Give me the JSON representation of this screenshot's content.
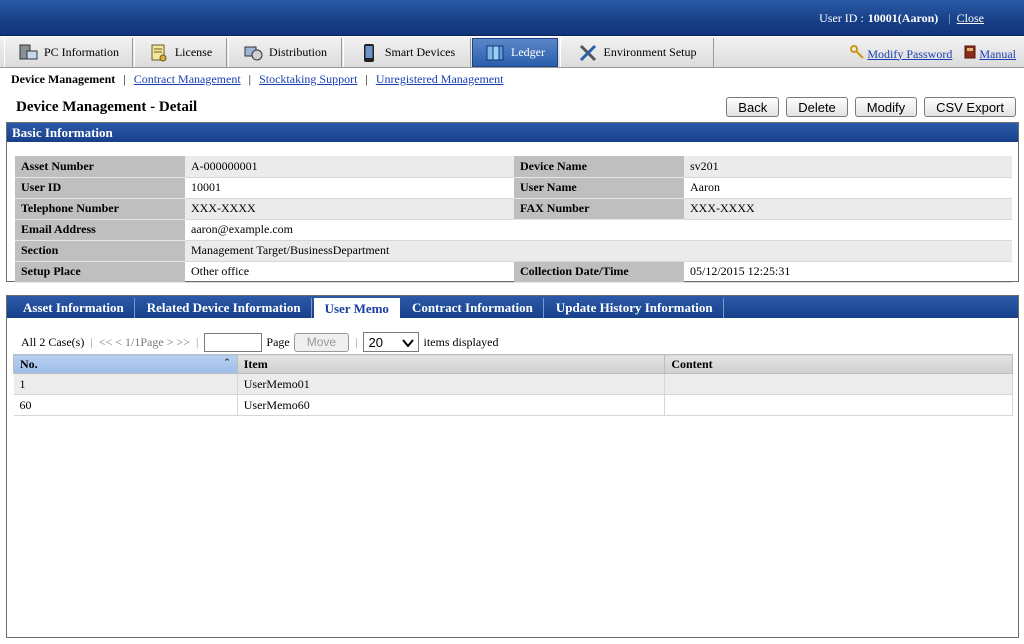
{
  "header": {
    "user_id_label": "User ID :",
    "user_id_value": "10001(Aaron)",
    "close_label": "Close"
  },
  "main_tabs": [
    {
      "label": "PC Information",
      "icon": "computer-icon"
    },
    {
      "label": "License",
      "icon": "license-icon"
    },
    {
      "label": "Distribution",
      "icon": "distribution-icon"
    },
    {
      "label": "Smart Devices",
      "icon": "smart-device-icon"
    },
    {
      "label": "Ledger",
      "icon": "ledger-icon",
      "active": true
    },
    {
      "label": "Environment Setup",
      "icon": "tools-icon"
    }
  ],
  "right_links": {
    "modify_password": "Modify Password",
    "manual": "Manual"
  },
  "subnav": {
    "current": "Device Management",
    "items": [
      "Contract Management",
      "Stocktaking Support",
      "Unregistered Management"
    ]
  },
  "page": {
    "title": "Device Management - Detail",
    "buttons": [
      "Back",
      "Delete",
      "Modify",
      "CSV Export"
    ]
  },
  "basic_info": {
    "heading": "Basic Information",
    "rows": [
      {
        "l1": "Asset Number",
        "v1": "A-000000001",
        "l2": "Device Name",
        "v2": "sv201"
      },
      {
        "l1": "User ID",
        "v1": "10001",
        "l2": "User Name",
        "v2": "Aaron"
      },
      {
        "l1": "Telephone Number",
        "v1": "XXX-XXXX",
        "l2": "FAX Number",
        "v2": "XXX-XXXX"
      },
      {
        "l1": "Email Address",
        "v1": "aaron@example.com",
        "l2": "",
        "v2": ""
      },
      {
        "l1": "Section",
        "v1": "Management Target/BusinessDepartment",
        "l2": "",
        "v2": ""
      },
      {
        "l1": "Setup Place",
        "v1": "Other office",
        "l2": "Collection Date/Time",
        "v2": "05/12/2015 12:25:31"
      }
    ]
  },
  "detail_tabs": {
    "tabs": [
      "Asset Information",
      "Related Device Information",
      "User Memo",
      "Contract Information",
      "Update History Information"
    ],
    "active": "User Memo"
  },
  "pager": {
    "count": "All 2 Case(s)",
    "nav": "<< < 1/1Page > >>",
    "page_label": "Page",
    "page_value": "",
    "move": "Move",
    "per_page": "20",
    "items_label": "items displayed"
  },
  "memo_table": {
    "columns": [
      "No.",
      "Item",
      "Content"
    ],
    "rows": [
      {
        "no": "1",
        "item": "UserMemo01",
        "content": ""
      },
      {
        "no": "60",
        "item": "UserMemo60",
        "content": ""
      }
    ]
  },
  "colors": {
    "header_blue": "#17408a",
    "link": "#1a3fb3",
    "label_gray": "#bfbfbf"
  }
}
